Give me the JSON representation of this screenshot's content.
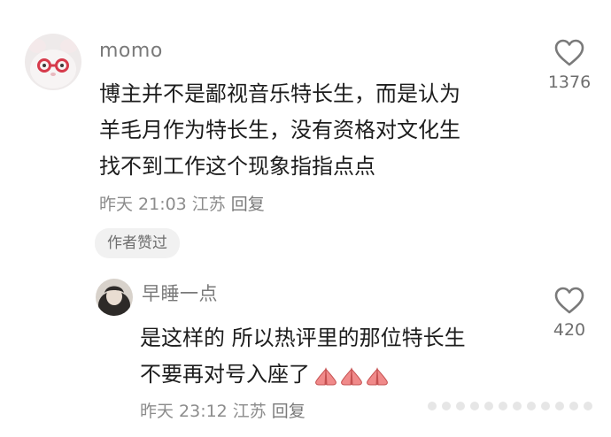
{
  "comment": {
    "username": "momo",
    "lines": [
      "博主并不是鄙视音乐特长生，而是认为",
      "羊毛月作为特长生，没有资格对文化生",
      "找不到工作这个现象指指点点"
    ],
    "date": "昨天",
    "time": "21:03",
    "location": "江苏",
    "reply_label": "回复",
    "author_badge": "作者赞过",
    "like_count": "1376",
    "like_icon": "heart-outline-icon"
  },
  "reply": {
    "username": "早睡一点",
    "lines": [
      "是这样的 所以热评里的那位特长生",
      "不要再对号入座了"
    ],
    "emojis": [
      "praying-hands-icon",
      "praying-hands-icon",
      "praying-hands-icon"
    ],
    "date": "昨天",
    "time": "23:12",
    "location": "江苏",
    "reply_label": "回复",
    "like_count": "420",
    "like_icon": "heart-outline-icon"
  },
  "colors": {
    "username": "#7a7a7a",
    "content": "#1d1d1d",
    "meta": "#8c8c8c",
    "badge_bg": "#f1f1f1"
  }
}
